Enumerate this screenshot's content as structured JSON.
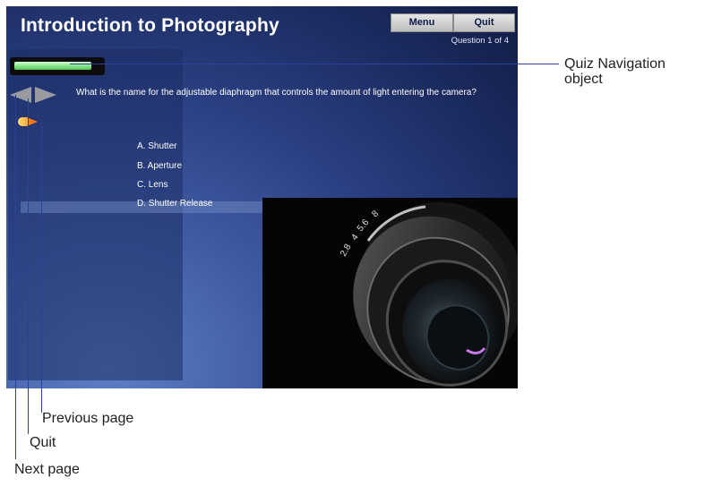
{
  "screen": {
    "title": "Introduction to Photography",
    "menu_label": "Menu",
    "quit_label": "Quit",
    "question_counter": "Question 1  of 4",
    "progress_fraction": 0.9,
    "question": "What is the name for the adjustable diaphragm that controls the amount of light entering the camera?",
    "answers": [
      "A. Shutter",
      "B. Aperture",
      "C. Lens",
      "D. Shutter Release"
    ],
    "lens_markings": [
      "2.8",
      "4",
      "5.6",
      "8"
    ]
  },
  "callouts": {
    "quiz_navigation": "Quiz Navigation object",
    "previous_page": "Previous page",
    "quit": "Quit",
    "next_page": "Next page"
  },
  "colors": {
    "callout_line": "#2b3f9e",
    "progress_green": "#7ee37e"
  },
  "icons": {
    "previous": "left-arrow-icon",
    "next": "right-arrow-icon",
    "quit": "quit-arrow-icon"
  }
}
